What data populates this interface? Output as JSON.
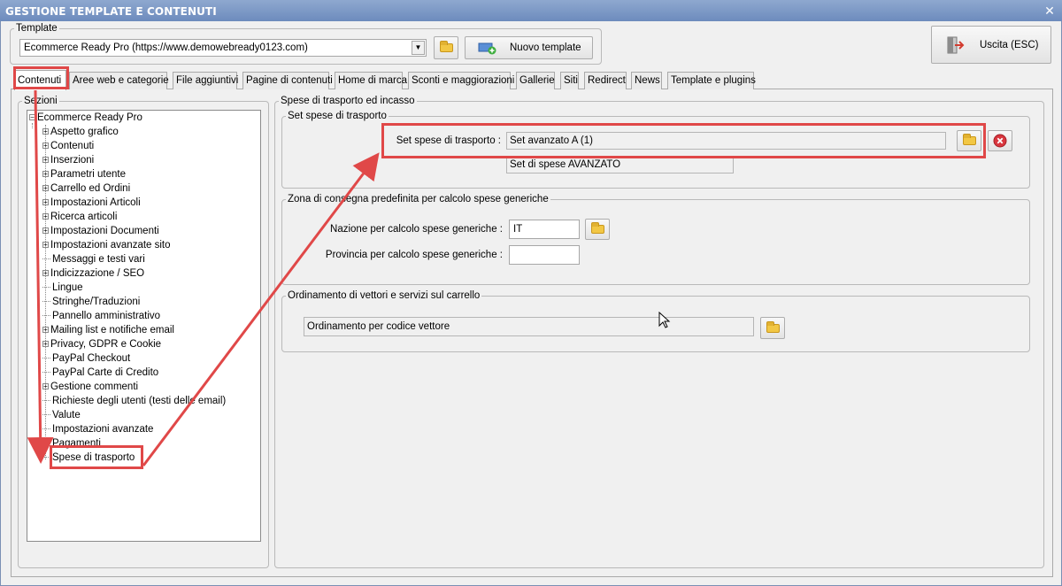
{
  "window": {
    "title": "GESTIONE TEMPLATE E CONTENUTI",
    "close_glyph": "✕"
  },
  "template_group": {
    "legend": "Template",
    "selected": "Ecommerce Ready Pro (https://www.demowebready0123.com)",
    "new_button": "Nuovo template"
  },
  "exit_button": "Uscita (ESC)",
  "tabs": [
    "Contenuti",
    "Aree web e categorie",
    "File aggiuntivi",
    "Pagine di contenuti",
    "Home di marca",
    "Sconti e maggiorazioni",
    "Gallerie",
    "Siti",
    "Redirect",
    "News",
    "Template e plugins"
  ],
  "sections": {
    "legend": "Sezioni",
    "root": "Ecommerce Ready Pro",
    "items": [
      {
        "label": "Aspetto grafico",
        "expandable": true
      },
      {
        "label": "Contenuti",
        "expandable": true
      },
      {
        "label": "Inserzioni",
        "expandable": true
      },
      {
        "label": "Parametri utente",
        "expandable": true
      },
      {
        "label": "Carrello ed Ordini",
        "expandable": true
      },
      {
        "label": "Impostazioni Articoli",
        "expandable": true
      },
      {
        "label": "Ricerca articoli",
        "expandable": true
      },
      {
        "label": "Impostazioni Documenti",
        "expandable": true
      },
      {
        "label": "Impostazioni avanzate sito",
        "expandable": true
      },
      {
        "label": "Messaggi e testi vari",
        "expandable": false
      },
      {
        "label": "Indicizzazione / SEO",
        "expandable": true
      },
      {
        "label": "Lingue",
        "expandable": false
      },
      {
        "label": "Stringhe/Traduzioni",
        "expandable": false
      },
      {
        "label": "Pannello amministrativo",
        "expandable": false
      },
      {
        "label": "Mailing list e notifiche email",
        "expandable": true
      },
      {
        "label": "Privacy, GDPR e Cookie",
        "expandable": true
      },
      {
        "label": "PayPal Checkout",
        "expandable": false
      },
      {
        "label": "PayPal Carte di Credito",
        "expandable": false
      },
      {
        "label": "Gestione commenti",
        "expandable": true
      },
      {
        "label": "Richieste degli utenti (testi delle email)",
        "expandable": false
      },
      {
        "label": "Valute",
        "expandable": false
      },
      {
        "label": "Impostazioni avanzate",
        "expandable": false
      },
      {
        "label": "Pagamenti",
        "expandable": false
      },
      {
        "label": "Spese di trasporto",
        "expandable": false
      }
    ]
  },
  "content": {
    "legend": "Spese di trasporto ed incasso",
    "set_group": {
      "legend": "Set spese di trasporto",
      "label": "Set spese di trasporto :",
      "value": "Set avanzato A (1)",
      "description": "Set di spese AVANZATO"
    },
    "zone_group": {
      "legend": "Zona di consegna predefinita per calcolo spese generiche",
      "nation_label": "Nazione per calcolo spese generiche :",
      "nation_value": "IT",
      "province_label": "Provincia per calcolo spese generiche :",
      "province_value": ""
    },
    "order_group": {
      "legend": "Ordinamento di vettori e servizi sul carrello",
      "value": "Ordinamento per codice vettore"
    }
  },
  "colors": {
    "highlight": "#e04848",
    "titlebar": "#7f9bc8"
  }
}
